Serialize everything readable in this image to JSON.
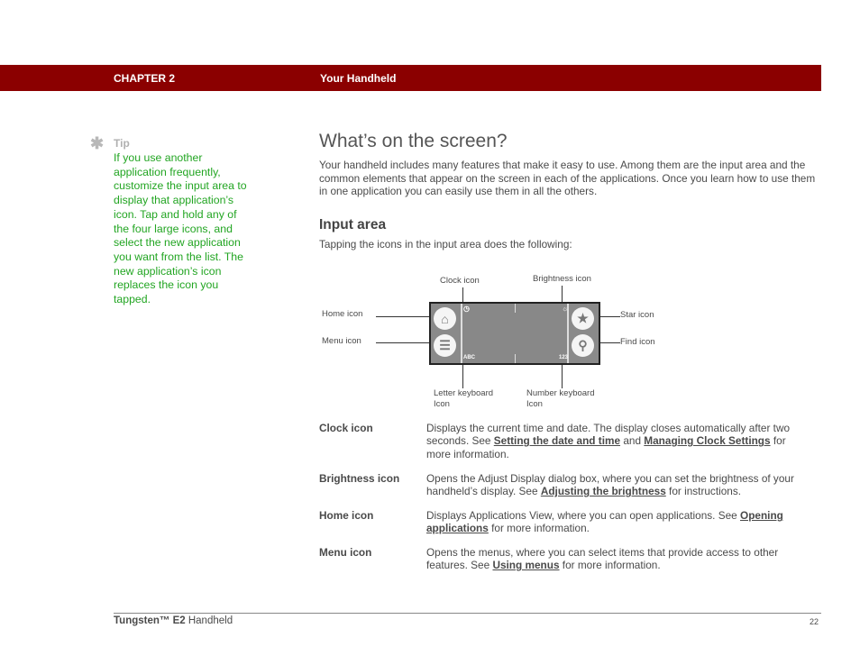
{
  "header": {
    "chapter": "CHAPTER 2",
    "title": "Your Handheld",
    "bar_color": "#8b0000"
  },
  "tip": {
    "icon": "asterisk-icon",
    "label": "Tip",
    "text": "If you use another application frequently, customize the input area to display that application’s icon. Tap and hold any of the four large icons, and select the new application you want from the list. The new application’s icon replaces the icon you tapped.",
    "color": "#22a522"
  },
  "main": {
    "title": "What’s on the screen?",
    "intro": "Your handheld includes many features that make it easy to use. Among them are the input area and the common elements that appear on the screen in each of the applications. Once you learn how to use them in one application you can easily use them in all the others.",
    "section_title": "Input area",
    "section_lead": "Tapping the icons in the input area does the following:"
  },
  "diagram": {
    "labels": {
      "clock": "Clock icon",
      "brightness": "Brightness icon",
      "home": "Home icon",
      "menu": "Menu icon",
      "star": "Star icon",
      "find": "Find icon",
      "letter_1": "Letter keyboard",
      "letter_2": "Icon",
      "number_1": "Number keyboard",
      "number_2": "Icon"
    },
    "screen_text": {
      "abc": "ABC",
      "num": "123"
    },
    "icons": {
      "home": "⌂",
      "menu": "☰",
      "star": "★",
      "find": "⚲",
      "clock": "◷",
      "brightness": "☼"
    }
  },
  "definitions": [
    {
      "term": "Clock icon",
      "pre": "Displays the current time and date. The display closes automatically after two seconds. See ",
      "link1": "Setting the date and time",
      "mid": " and ",
      "link2": "Managing Clock Settings",
      "post": " for more information."
    },
    {
      "term": "Brightness icon",
      "pre": "Opens the Adjust Display dialog box, where you can set the brightness of your handheld’s display. See ",
      "link1": "Adjusting the brightness",
      "post": " for instructions."
    },
    {
      "term": "Home icon",
      "pre": "Displays Applications View, where you can open applications. See ",
      "link1": "Opening applications",
      "post": " for more information."
    },
    {
      "term": "Menu icon",
      "pre": "Opens the menus, where you can select items that provide access to other features. See ",
      "link1": "Using menus",
      "post": " for more information."
    }
  ],
  "footer": {
    "product_bold": "Tungsten™ E2",
    "product_rest": " Handheld",
    "page_number": "22"
  }
}
